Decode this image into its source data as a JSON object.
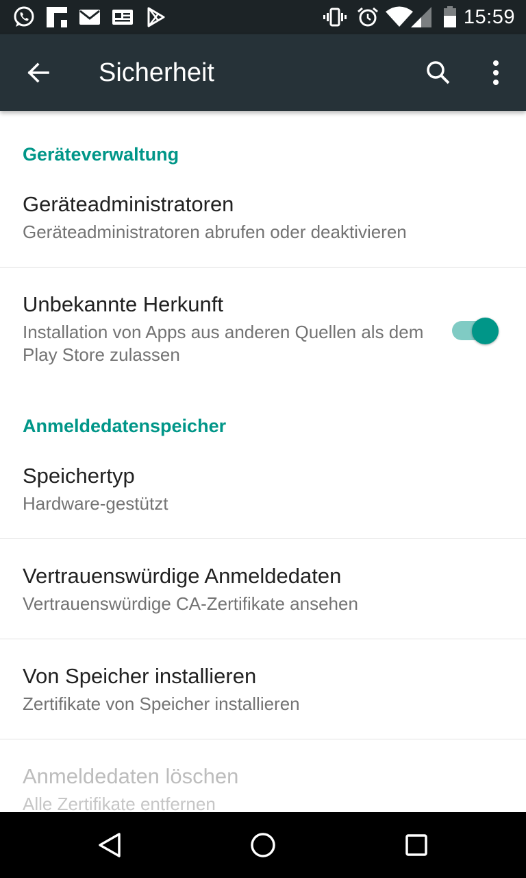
{
  "status_bar": {
    "time": "15:59",
    "left_icons": [
      "whatsapp-icon",
      "flipboard-icon",
      "gmail-icon",
      "news-icon",
      "play-store-icon"
    ],
    "right_icons": [
      "vibrate-icon",
      "alarm-icon",
      "wifi-icon",
      "signal-icon",
      "battery-icon"
    ]
  },
  "toolbar": {
    "title": "Sicherheit",
    "back_icon": "arrow-back-icon",
    "search_icon": "search-icon",
    "overflow_icon": "more-vert-icon"
  },
  "sections": [
    {
      "header": "Geräteverwaltung",
      "items": [
        {
          "title": "Geräteadministratoren",
          "summary": "Geräteadministratoren abrufen oder deaktivieren"
        },
        {
          "title": "Unbekannte Herkunft",
          "summary": "Installation von Apps aus anderen Quellen als dem Play Store zulassen",
          "switch_on": true
        }
      ]
    },
    {
      "header": "Anmeldedatenspeicher",
      "items": [
        {
          "title": "Speichertyp",
          "summary": "Hardware-gestützt"
        },
        {
          "title": "Vertrauenswürdige Anmeldedaten",
          "summary": "Vertrauenswürdige CA-Zertifikate ansehen"
        },
        {
          "title": "Von Speicher installieren",
          "summary": "Zertifikate von Speicher installieren"
        },
        {
          "title": "Anmeldedaten löschen",
          "summary": "Alle Zertifikate entfernen",
          "disabled": true
        }
      ]
    }
  ],
  "colors": {
    "accent": "#009688",
    "toolbar": "#263238",
    "status_bar": "#1c2326",
    "switch_track": "#80cbc4"
  },
  "nav_bar": {
    "icons": [
      "back-triangle-icon",
      "home-circle-icon",
      "recents-square-icon"
    ]
  }
}
